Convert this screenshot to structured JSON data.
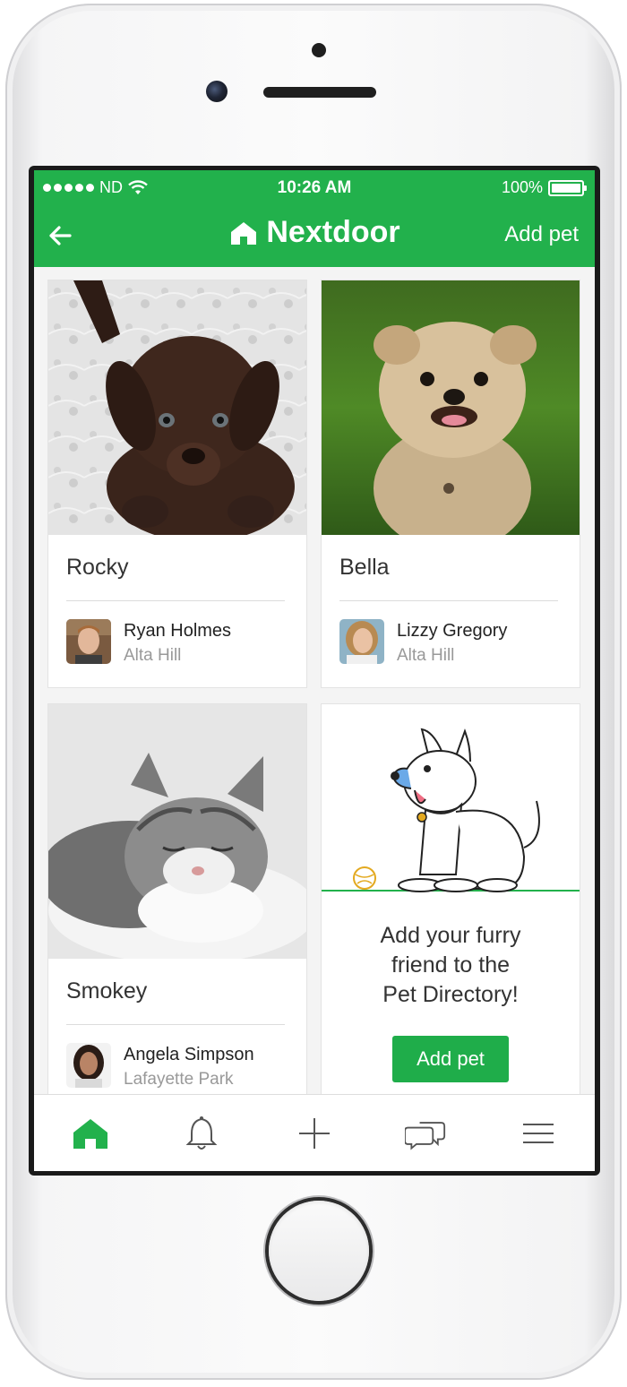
{
  "status_bar": {
    "carrier": "ND",
    "time": "10:26 AM",
    "battery": "100%"
  },
  "nav": {
    "brand": "Nextdoor",
    "add_pet_label": "Add pet"
  },
  "pets": [
    {
      "name": "Rocky",
      "owner": "Ryan Holmes",
      "neighborhood": "Alta Hill"
    },
    {
      "name": "Bella",
      "owner": "Lizzy Gregory",
      "neighborhood": "Alta Hill"
    },
    {
      "name": "Smokey",
      "owner": "Angela Simpson",
      "neighborhood": "Lafayette Park"
    }
  ],
  "promo": {
    "line1": "Add your furry",
    "line2": "friend to the",
    "line3": "Pet Directory!",
    "button_label": "Add pet"
  },
  "tabs": [
    "home-icon",
    "bell-icon",
    "plus-icon",
    "chat-icon",
    "menu-icon"
  ],
  "colors": {
    "brand_green": "#22b14c",
    "button_green": "#1fad4a"
  }
}
